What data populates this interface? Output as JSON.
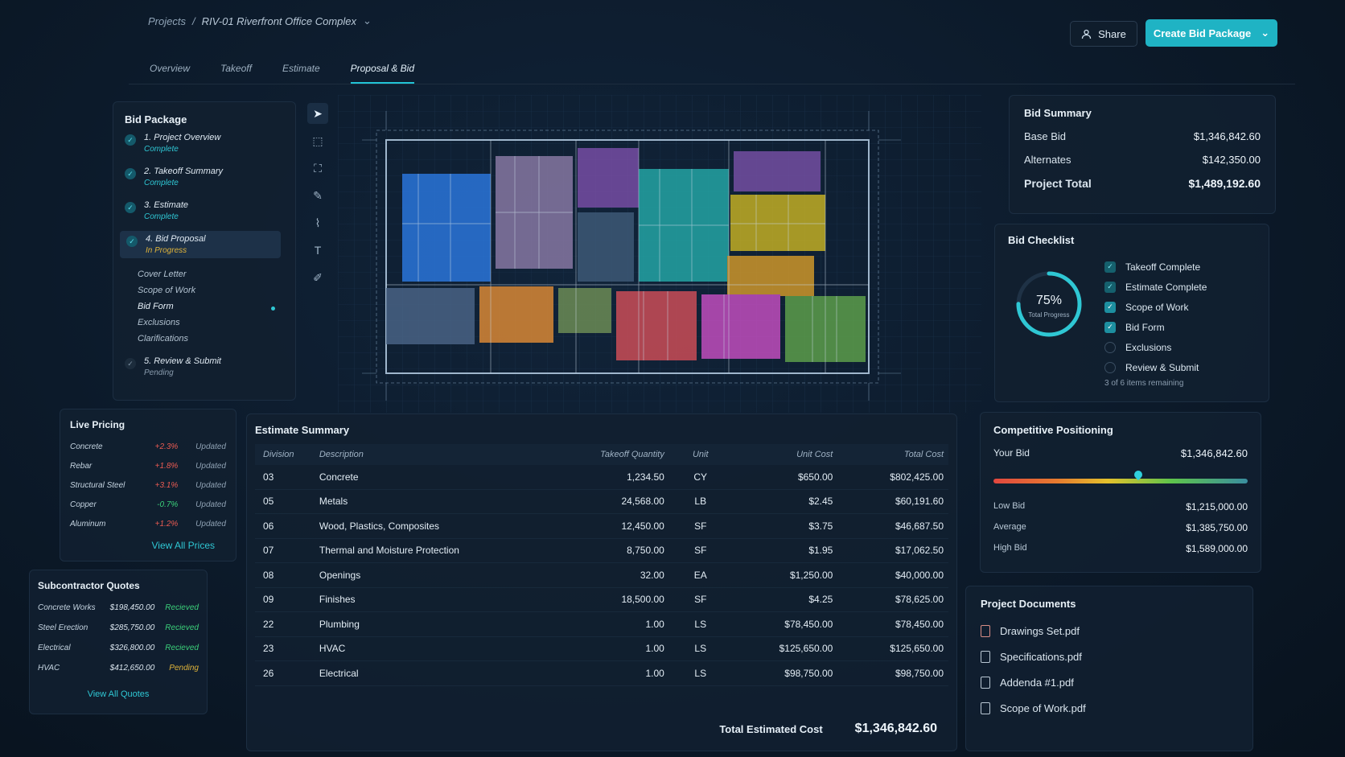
{
  "breadcrumb": {
    "root": "Projects",
    "sep": "/",
    "current": "RIV-01  Riverfront Office Complex",
    "chevron": "⌄"
  },
  "header": {
    "share_label": "Share",
    "create_label": "Create Bid Package",
    "create_chevron": "⌄"
  },
  "tabs": [
    {
      "label": "Overview"
    },
    {
      "label": "Takeoff"
    },
    {
      "label": "Estimate"
    },
    {
      "label": "Proposal & Bid"
    }
  ],
  "bid_package": {
    "title": "Bid Package",
    "steps": [
      {
        "name": "1. Project Overview",
        "status": "Complete"
      },
      {
        "name": "2. Takeoff Summary",
        "status": "Complete"
      },
      {
        "name": "3. Estimate",
        "status": "Complete"
      },
      {
        "name": "4. Bid Proposal",
        "status": "In Progress"
      },
      {
        "name": "5. Review & Submit",
        "status": "Pending"
      }
    ],
    "substeps": [
      "Cover Letter",
      "Scope of Work",
      "Bid Form",
      "Exclusions",
      "Clarifications"
    ]
  },
  "bid_summary": {
    "title": "Bid Summary",
    "base_label": "Base Bid",
    "base_value": "$1,346,842.60",
    "alt_label": "Alternates",
    "alt_value": "$142,350.00",
    "total_label": "Project Total",
    "total_value": "$1,489,192.60"
  },
  "bid_checklist": {
    "title": "Bid Checklist",
    "progress_label": "75%",
    "progress_fraction": 0.75,
    "progress_caption": "Total Progress",
    "items": [
      {
        "label": "Takeoff Complete",
        "state": "done"
      },
      {
        "label": "Estimate Complete",
        "state": "done"
      },
      {
        "label": "Scope of Work",
        "state": "checked"
      },
      {
        "label": "Bid Form",
        "state": "checked"
      },
      {
        "label": "Exclusions",
        "state": "open"
      },
      {
        "label": "Review & Submit",
        "state": "open"
      }
    ],
    "footer": "3 of 6 items remaining"
  },
  "competitive": {
    "title": "Competitive Positioning",
    "your_label": "Your Bid",
    "your_value": "$1,346,842.60",
    "position_fraction": 0.57,
    "low_label": "Low Bid",
    "low_value": "$1,215,000.00",
    "avg_label": "Average",
    "avg_value": "$1,385,750.00",
    "high_label": "High Bid",
    "high_value": "$1,589,000.00"
  },
  "documents": {
    "title": "Project Documents",
    "files": [
      "Drawings Set.pdf",
      "Specifications.pdf",
      "Addenda #1.pdf",
      "Scope of Work.pdf"
    ]
  },
  "live_pricing": {
    "title": "Live Pricing",
    "rows": [
      {
        "name": "Concrete",
        "change": "+2.3%",
        "status": "Updated"
      },
      {
        "name": "Rebar",
        "change": "+1.8%",
        "status": "Updated"
      },
      {
        "name": "Structural Steel",
        "change": "+3.1%",
        "status": "Updated"
      },
      {
        "name": "Copper",
        "change": "-0.7%",
        "status": "Updated"
      },
      {
        "name": "Aluminum",
        "change": "+1.2%",
        "status": "Updated"
      }
    ],
    "link": "View All Prices"
  },
  "sub_quotes": {
    "title": "Subcontractor Quotes",
    "rows": [
      {
        "name": "Concrete Works",
        "amount": "$198,450.00",
        "status": "Recieved"
      },
      {
        "name": "Steel Erection",
        "amount": "$285,750.00",
        "status": "Recieved"
      },
      {
        "name": "Electrical",
        "amount": "$326,800.00",
        "status": "Recieved"
      },
      {
        "name": "HVAC",
        "amount": "$412,650.00",
        "status": "Pending"
      }
    ],
    "link": "View All Quotes"
  },
  "estimate": {
    "title": "Estimate Summary",
    "headers": {
      "division": "Division",
      "description": "Description",
      "qty": "Takeoff Quantity",
      "unit": "Unit",
      "unit_cost": "Unit Cost",
      "total": "Total Cost"
    },
    "rows": [
      {
        "division": "03",
        "description": "Concrete",
        "qty": "1,234.50",
        "unit": "CY",
        "unit_cost": "$650.00",
        "total": "$802,425.00"
      },
      {
        "division": "05",
        "description": "Metals",
        "qty": "24,568.00",
        "unit": "LB",
        "unit_cost": "$2.45",
        "total": "$60,191.60"
      },
      {
        "division": "06",
        "description": "Wood, Plastics, Composites",
        "qty": "12,450.00",
        "unit": "SF",
        "unit_cost": "$3.75",
        "total": "$46,687.50"
      },
      {
        "division": "07",
        "description": "Thermal and Moisture Protection",
        "qty": "8,750.00",
        "unit": "SF",
        "unit_cost": "$1.95",
        "total": "$17,062.50"
      },
      {
        "division": "08",
        "description": "Openings",
        "qty": "32.00",
        "unit": "EA",
        "unit_cost": "$1,250.00",
        "total": "$40,000.00"
      },
      {
        "division": "09",
        "description": "Finishes",
        "qty": "18,500.00",
        "unit": "SF",
        "unit_cost": "$4.25",
        "total": "$78,625.00"
      },
      {
        "division": "22",
        "description": "Plumbing",
        "qty": "1.00",
        "unit": "LS",
        "unit_cost": "$78,450.00",
        "total": "$78,450.00"
      },
      {
        "division": "23",
        "description": "HVAC",
        "qty": "1.00",
        "unit": "LS",
        "unit_cost": "$125,650.00",
        "total": "$125,650.00"
      },
      {
        "division": "26",
        "description": "Electrical",
        "qty": "1.00",
        "unit": "LS",
        "unit_cost": "$98,750.00",
        "total": "$98,750.00"
      }
    ],
    "total_label": "Total Estimated Cost",
    "total_value": "$1,346,842.60"
  },
  "colors": {
    "accent": "#1fb3c4",
    "complete": "#2fc7d4",
    "progress": "#e0b43a",
    "received": "#3bd07a"
  }
}
